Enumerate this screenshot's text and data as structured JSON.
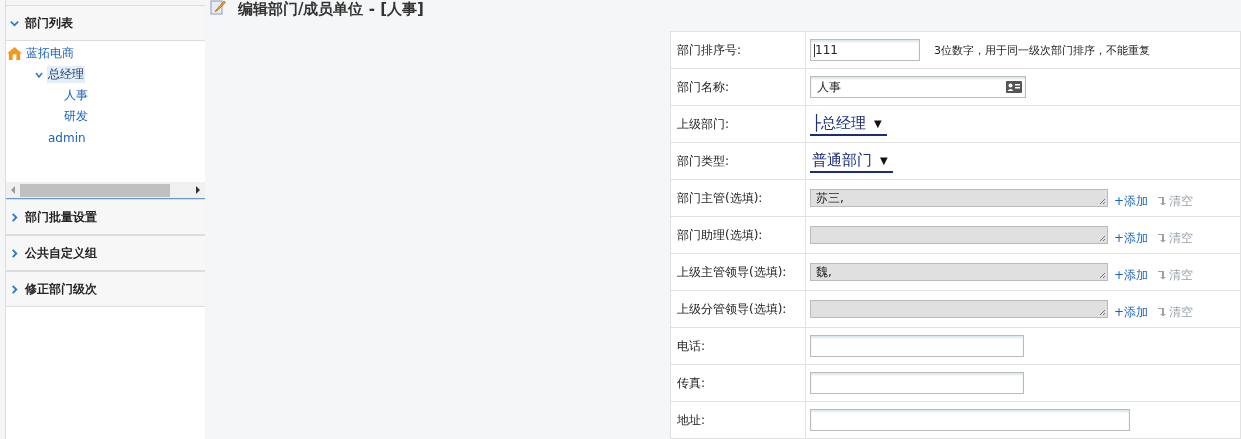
{
  "sidebar": {
    "sections": [
      {
        "title": "部门列表",
        "expanded": true
      },
      {
        "title": "部门批量设置",
        "expanded": false
      },
      {
        "title": "公共自定义组",
        "expanded": false
      },
      {
        "title": "修正部门级次",
        "expanded": false
      }
    ],
    "tree": [
      {
        "label": "蓝拓电商",
        "selected": false,
        "children": [
          {
            "label": "总经理",
            "expanded": true,
            "selected": true,
            "children": [
              {
                "label": "人事",
                "selected": false
              },
              {
                "label": "研发",
                "selected": false
              }
            ]
          },
          {
            "label": "admin",
            "selected": false
          }
        ]
      }
    ]
  },
  "page_title": "编辑部门/成员单位 - [人事]",
  "form": [
    {
      "label": "部门排序号:",
      "kind": "text",
      "value": "111",
      "hint": "3位数字，用于同一级次部门排序，不能重复"
    },
    {
      "label": "部门名称:",
      "kind": "card",
      "value": "人事"
    },
    {
      "label": "上级部门:",
      "kind": "select",
      "value": "├总经理",
      "caret": "▼"
    },
    {
      "label": "部门类型:",
      "kind": "select",
      "value": "普通部门",
      "caret": "▼"
    },
    {
      "label": "部门主管(选填):",
      "kind": "picker",
      "value": "苏三,",
      "add": "+添加",
      "clear": "清空"
    },
    {
      "label": "部门助理(选填):",
      "kind": "picker",
      "add": "+添加",
      "clear": "清空"
    },
    {
      "label": "上级主管领导(选填):",
      "kind": "picker",
      "value": "魏,",
      "add": "+添加",
      "clear": "清空"
    },
    {
      "label": "上级分管领导(选填):",
      "kind": "picker",
      "add": "+添加",
      "clear": "清空"
    },
    {
      "label": "电话:",
      "kind": "text"
    },
    {
      "label": "传真:",
      "kind": "text"
    },
    {
      "label": "地址:",
      "kind": "wide"
    }
  ]
}
